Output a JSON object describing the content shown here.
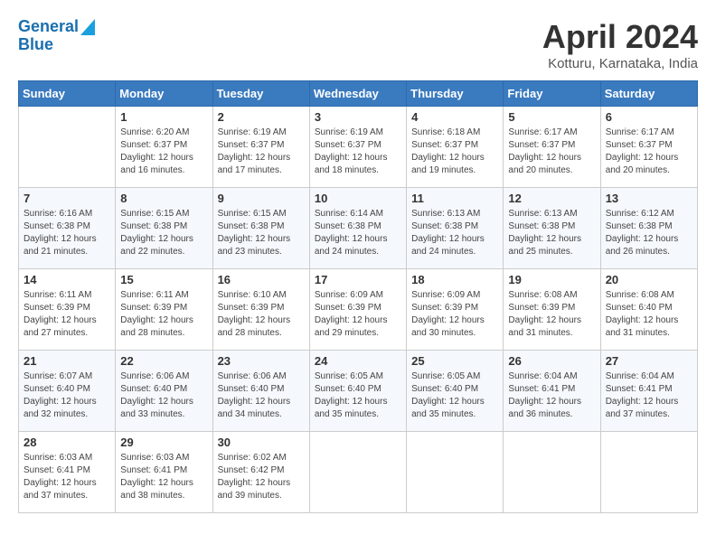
{
  "header": {
    "logo_line1": "General",
    "logo_line2": "Blue",
    "month_title": "April 2024",
    "location": "Kotturu, Karnataka, India"
  },
  "days_of_week": [
    "Sunday",
    "Monday",
    "Tuesday",
    "Wednesday",
    "Thursday",
    "Friday",
    "Saturday"
  ],
  "weeks": [
    [
      {
        "day": "",
        "sunrise": "",
        "sunset": "",
        "daylight": ""
      },
      {
        "day": "1",
        "sunrise": "6:20 AM",
        "sunset": "6:37 PM",
        "daylight": "12 hours and 16 minutes."
      },
      {
        "day": "2",
        "sunrise": "6:19 AM",
        "sunset": "6:37 PM",
        "daylight": "12 hours and 17 minutes."
      },
      {
        "day": "3",
        "sunrise": "6:19 AM",
        "sunset": "6:37 PM",
        "daylight": "12 hours and 18 minutes."
      },
      {
        "day": "4",
        "sunrise": "6:18 AM",
        "sunset": "6:37 PM",
        "daylight": "12 hours and 19 minutes."
      },
      {
        "day": "5",
        "sunrise": "6:17 AM",
        "sunset": "6:37 PM",
        "daylight": "12 hours and 20 minutes."
      },
      {
        "day": "6",
        "sunrise": "6:17 AM",
        "sunset": "6:37 PM",
        "daylight": "12 hours and 20 minutes."
      }
    ],
    [
      {
        "day": "7",
        "sunrise": "6:16 AM",
        "sunset": "6:38 PM",
        "daylight": "12 hours and 21 minutes."
      },
      {
        "day": "8",
        "sunrise": "6:15 AM",
        "sunset": "6:38 PM",
        "daylight": "12 hours and 22 minutes."
      },
      {
        "day": "9",
        "sunrise": "6:15 AM",
        "sunset": "6:38 PM",
        "daylight": "12 hours and 23 minutes."
      },
      {
        "day": "10",
        "sunrise": "6:14 AM",
        "sunset": "6:38 PM",
        "daylight": "12 hours and 24 minutes."
      },
      {
        "day": "11",
        "sunrise": "6:13 AM",
        "sunset": "6:38 PM",
        "daylight": "12 hours and 24 minutes."
      },
      {
        "day": "12",
        "sunrise": "6:13 AM",
        "sunset": "6:38 PM",
        "daylight": "12 hours and 25 minutes."
      },
      {
        "day": "13",
        "sunrise": "6:12 AM",
        "sunset": "6:38 PM",
        "daylight": "12 hours and 26 minutes."
      }
    ],
    [
      {
        "day": "14",
        "sunrise": "6:11 AM",
        "sunset": "6:39 PM",
        "daylight": "12 hours and 27 minutes."
      },
      {
        "day": "15",
        "sunrise": "6:11 AM",
        "sunset": "6:39 PM",
        "daylight": "12 hours and 28 minutes."
      },
      {
        "day": "16",
        "sunrise": "6:10 AM",
        "sunset": "6:39 PM",
        "daylight": "12 hours and 28 minutes."
      },
      {
        "day": "17",
        "sunrise": "6:09 AM",
        "sunset": "6:39 PM",
        "daylight": "12 hours and 29 minutes."
      },
      {
        "day": "18",
        "sunrise": "6:09 AM",
        "sunset": "6:39 PM",
        "daylight": "12 hours and 30 minutes."
      },
      {
        "day": "19",
        "sunrise": "6:08 AM",
        "sunset": "6:39 PM",
        "daylight": "12 hours and 31 minutes."
      },
      {
        "day": "20",
        "sunrise": "6:08 AM",
        "sunset": "6:40 PM",
        "daylight": "12 hours and 31 minutes."
      }
    ],
    [
      {
        "day": "21",
        "sunrise": "6:07 AM",
        "sunset": "6:40 PM",
        "daylight": "12 hours and 32 minutes."
      },
      {
        "day": "22",
        "sunrise": "6:06 AM",
        "sunset": "6:40 PM",
        "daylight": "12 hours and 33 minutes."
      },
      {
        "day": "23",
        "sunrise": "6:06 AM",
        "sunset": "6:40 PM",
        "daylight": "12 hours and 34 minutes."
      },
      {
        "day": "24",
        "sunrise": "6:05 AM",
        "sunset": "6:40 PM",
        "daylight": "12 hours and 35 minutes."
      },
      {
        "day": "25",
        "sunrise": "6:05 AM",
        "sunset": "6:40 PM",
        "daylight": "12 hours and 35 minutes."
      },
      {
        "day": "26",
        "sunrise": "6:04 AM",
        "sunset": "6:41 PM",
        "daylight": "12 hours and 36 minutes."
      },
      {
        "day": "27",
        "sunrise": "6:04 AM",
        "sunset": "6:41 PM",
        "daylight": "12 hours and 37 minutes."
      }
    ],
    [
      {
        "day": "28",
        "sunrise": "6:03 AM",
        "sunset": "6:41 PM",
        "daylight": "12 hours and 37 minutes."
      },
      {
        "day": "29",
        "sunrise": "6:03 AM",
        "sunset": "6:41 PM",
        "daylight": "12 hours and 38 minutes."
      },
      {
        "day": "30",
        "sunrise": "6:02 AM",
        "sunset": "6:42 PM",
        "daylight": "12 hours and 39 minutes."
      },
      {
        "day": "",
        "sunrise": "",
        "sunset": "",
        "daylight": ""
      },
      {
        "day": "",
        "sunrise": "",
        "sunset": "",
        "daylight": ""
      },
      {
        "day": "",
        "sunrise": "",
        "sunset": "",
        "daylight": ""
      },
      {
        "day": "",
        "sunrise": "",
        "sunset": "",
        "daylight": ""
      }
    ]
  ],
  "labels": {
    "sunrise_prefix": "Sunrise: ",
    "sunset_prefix": "Sunset: ",
    "daylight_prefix": "Daylight: "
  }
}
